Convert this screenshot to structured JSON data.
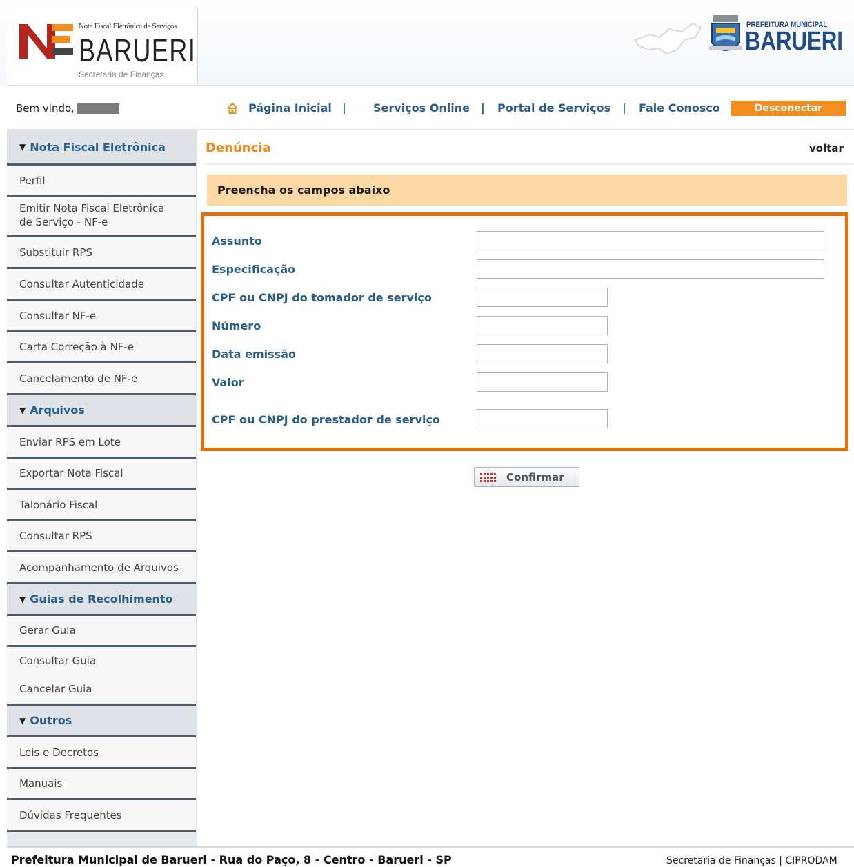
{
  "header": {
    "logo_small": "Nota Fiscal Eletrônica de Serviços",
    "logo_big": "BARUERI",
    "logo_sub": "Secretaria de Finanças",
    "pref_small": "PREFEITURA MUNICIPAL",
    "pref_big": "BARUERI"
  },
  "topnav": {
    "welcome": "Bem vindo,",
    "home": "Página Inicial",
    "sep": "|",
    "online": "Serviços Online",
    "portal": "Portal de Serviços",
    "contact": "Fale Conosco",
    "logout": "Desconectar"
  },
  "sidebar": {
    "nfe_head": "Nota Fiscal Eletrônica",
    "perfil": "Perfil",
    "emitir_1": "Emitir Nota Fiscal Eletrônica",
    "emitir_2": "de Serviço - NF-e",
    "substituir": "Substituir RPS",
    "autenticidade": "Consultar Autenticidade",
    "consultar_nfe": "Consultar NF-e",
    "carta": "Carta Correção à NF-e",
    "cancelamento": "Cancelamento de NF-e",
    "arquivos_head": "Arquivos",
    "enviar": "Enviar RPS em Lote",
    "exportar": "Exportar Nota Fiscal",
    "talonario": "Talonário Fiscal",
    "consultar_rps": "Consultar RPS",
    "acompanhamento": "Acompanhamento de Arquivos",
    "guias_head": "Guias de Recolhimento",
    "gerar": "Gerar Guia",
    "consultar_guia": "Consultar Guia",
    "cancelar_guia": "Cancelar Guia",
    "outros_head": "Outros",
    "leis": "Leis e Decretos",
    "manuais": "Manuais",
    "duvidas": "Dúvidas Frequentes"
  },
  "main": {
    "title": "Denúncia",
    "back": "voltar",
    "instruction": "Preencha os campos abaixo",
    "fields": {
      "assunto": "Assunto",
      "especificacao": "Especificação",
      "cpf_tomador": "CPF ou CNPJ do tomador de serviço",
      "numero": "Número",
      "data_emissao": "Data emissão",
      "valor": "Valor",
      "cpf_prestador": "CPF ou CNPJ do prestador de serviço"
    },
    "confirm": "Confirmar"
  },
  "footer": {
    "address": "Prefeitura Municipal de Barueri - Rua do Paço, 8 - Centro - Barueri - SP",
    "credit": "Secretaria de Finanças | CIPRODAM"
  },
  "colors": {
    "accent_orange": "#e46f0c",
    "link_blue": "#2b5f8a",
    "info_bar": "#fcd9a4"
  }
}
